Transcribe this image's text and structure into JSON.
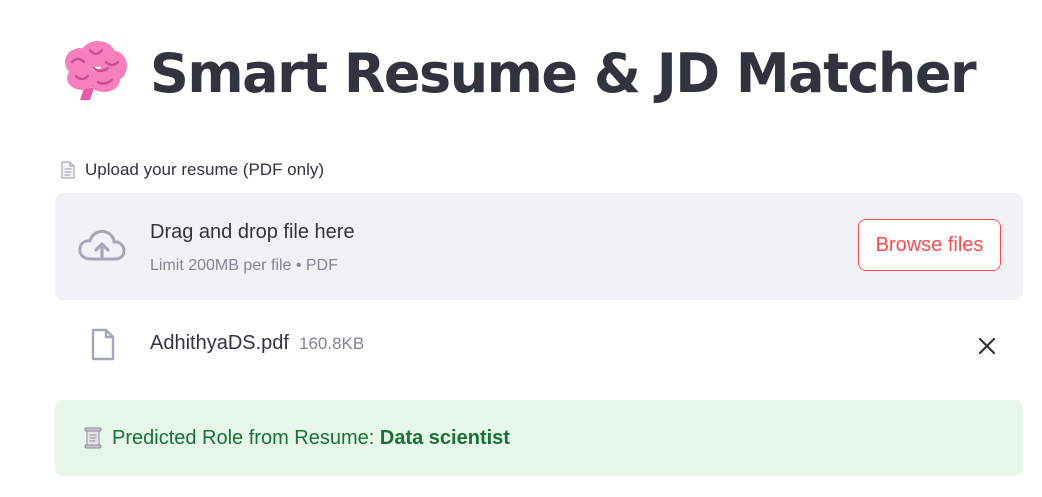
{
  "header": {
    "title": "Smart Resume & JD Matcher",
    "icon": "brain-icon"
  },
  "uploader": {
    "label_icon": "document-icon",
    "label": "Upload your resume (PDF only)",
    "dropzone_icon": "cloud-upload-icon",
    "dropzone_title": "Drag and drop file here",
    "dropzone_subtitle": "Limit 200MB per file • PDF",
    "browse_label": "Browse files",
    "uploaded_file": {
      "icon": "file-icon",
      "name": "AdhithyaDS.pdf",
      "size": "160.8KB",
      "remove_icon": "close-icon"
    }
  },
  "result": {
    "icon": "scroll-icon",
    "label": "Predicted Role from Resume: ",
    "value": "Data scientist"
  },
  "colors": {
    "accent": "#ff4b4b",
    "text": "#31333f",
    "muted": "#808495",
    "dropzone_bg": "#f0f2f6",
    "success_bg": "#e6f6ea",
    "success_text": "#177233",
    "brain": "#f77fbe"
  }
}
